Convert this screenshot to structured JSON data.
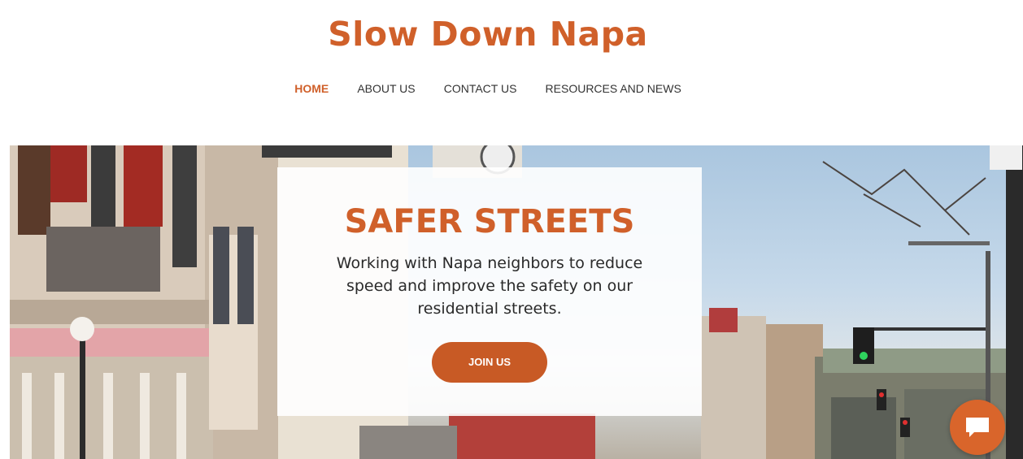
{
  "site": {
    "title": "Slow Down Napa"
  },
  "nav": {
    "items": [
      {
        "label": "HOME",
        "active": true
      },
      {
        "label": "ABOUT US"
      },
      {
        "label": "CONTACT US"
      },
      {
        "label": "RESOURCES AND NEWS"
      }
    ]
  },
  "hero": {
    "heading": "SAFER STREETS",
    "text": "Working with Napa neighbors to reduce speed and improve the safety on our residential streets.",
    "button_label": "JOIN US",
    "image_subject": "downtown Napa street with Opera House buildings"
  },
  "chat": {
    "icon": "chat-bubble-icon"
  },
  "colors": {
    "accent": "#d0602a",
    "nav_text": "#333333",
    "button": "#c85a25"
  }
}
